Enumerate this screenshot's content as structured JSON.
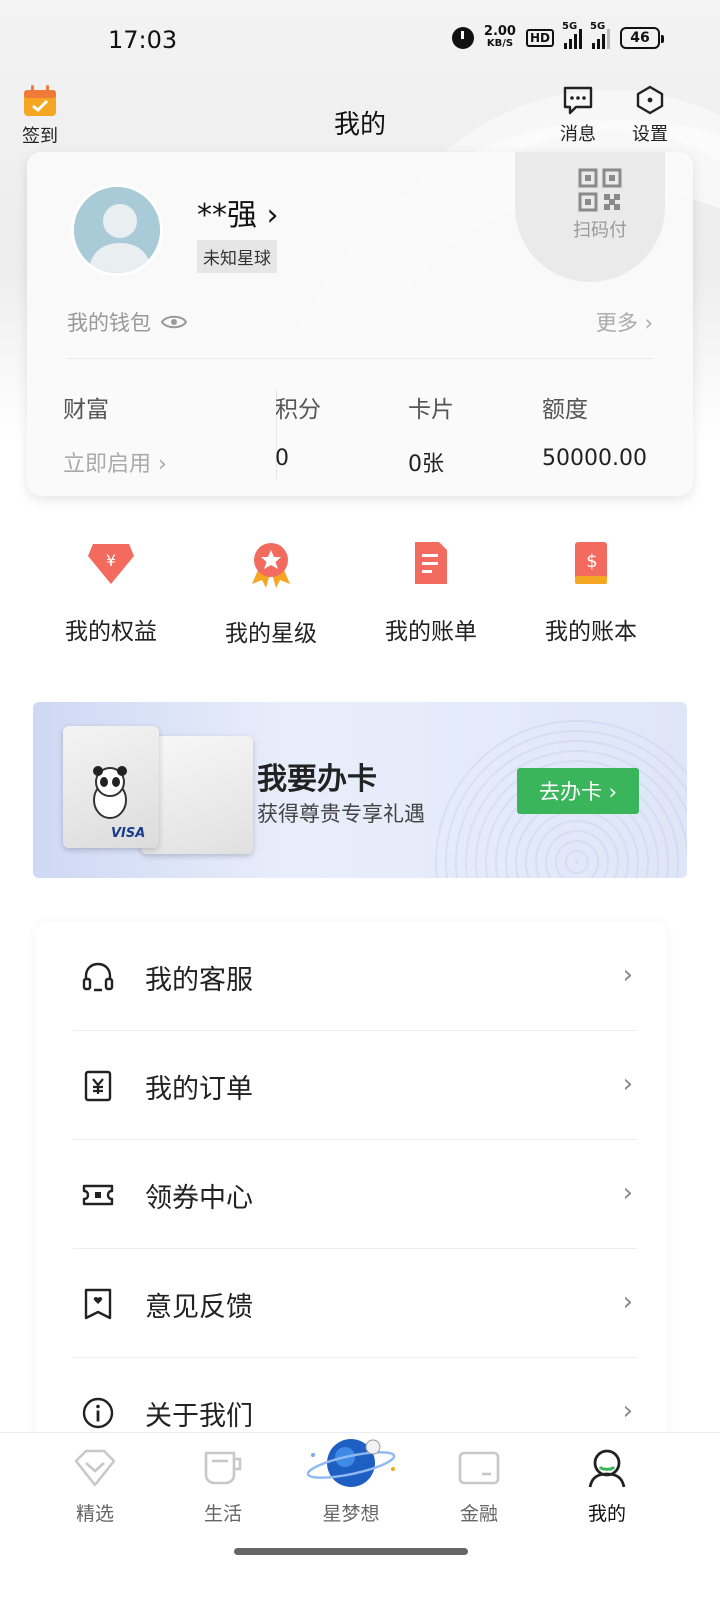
{
  "status_bar": {
    "time": "17:03",
    "net_speed": "2.00",
    "net_unit": "KB/S",
    "hd": "HD",
    "sig1": "5G",
    "sig2": "5G",
    "battery": "46"
  },
  "header": {
    "title": "我的",
    "signin_label": "签到",
    "message_label": "消息",
    "settings_label": "设置"
  },
  "profile": {
    "username": "**强",
    "chevron": "›",
    "planet_tag": "未知星球",
    "qr_label": "扫码付",
    "wallet_label": "我的钱包",
    "more_label": "更多 ›"
  },
  "stats": {
    "wealth_label": "财富",
    "wealth_value": "立即启用 ›",
    "points_label": "积分",
    "points_value": "0",
    "cards_label": "卡片",
    "cards_value": "0张",
    "limit_label": "额度",
    "limit_value": "50000.00"
  },
  "quick_actions": [
    {
      "label": "我的权益",
      "icon": "diamond-yuan-icon",
      "color": "#f05a4f"
    },
    {
      "label": "我的星级",
      "icon": "medal-star-icon",
      "color": "#f05a4f"
    },
    {
      "label": "我的账单",
      "icon": "bill-icon",
      "color": "#f05a4f"
    },
    {
      "label": "我的账本",
      "icon": "ledger-dollar-icon",
      "color": "#f05a4f"
    }
  ],
  "banner": {
    "title": "我要办卡",
    "subtitle": "获得尊贵专享礼遇",
    "button": "去办卡 ›",
    "card_brand": "VISA",
    "accent": "#3bb55c"
  },
  "menu": [
    {
      "label": "我的客服",
      "icon": "headset-icon"
    },
    {
      "label": "我的订单",
      "icon": "order-yuan-icon"
    },
    {
      "label": "领券中心",
      "icon": "coupon-icon"
    },
    {
      "label": "意见反馈",
      "icon": "feedback-icon"
    },
    {
      "label": "关于我们",
      "icon": "info-icon"
    }
  ],
  "menu_chevron": "›",
  "tabs": [
    {
      "label": "精选",
      "icon": "diamond-tab-icon",
      "active": false
    },
    {
      "label": "生活",
      "icon": "cup-tab-icon",
      "active": false
    },
    {
      "label": "星梦想",
      "icon": "planet-tab-icon",
      "active": false
    },
    {
      "label": "金融",
      "icon": "card-tab-icon",
      "active": false
    },
    {
      "label": "我的",
      "icon": "person-tab-icon",
      "active": true
    }
  ]
}
